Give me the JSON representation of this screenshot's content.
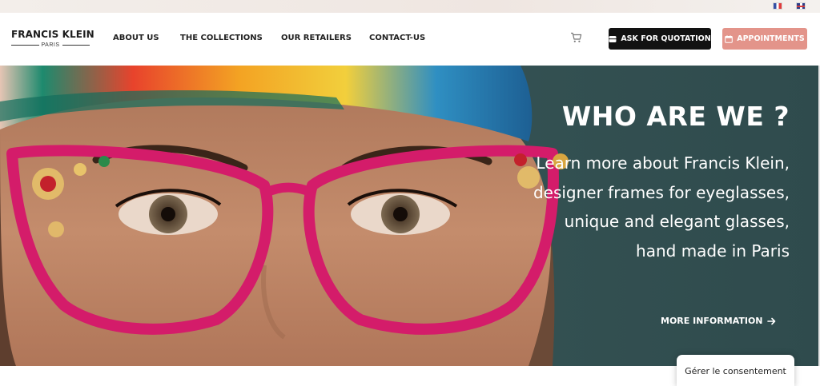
{
  "flags": [
    {
      "icon": "french-flag-icon"
    },
    {
      "icon": "english-flag-icon"
    }
  ],
  "logo": {
    "name": "FRANCIS KLEIN",
    "subtitle": "PARIS"
  },
  "nav": {
    "items": [
      {
        "label": "ABOUT US"
      },
      {
        "label": "THE COLLECTIONS"
      },
      {
        "label": "OUR RETAILERS"
      },
      {
        "label": "CONTACT-US"
      }
    ]
  },
  "header": {
    "cart_icon": "cart-icon",
    "quote_button": "ASK FOR QUOTATION",
    "appointments_button": "APPOINTMENTS"
  },
  "hero": {
    "title": "WHO ARE WE ?",
    "lines": [
      "Learn more about Francis Klein,",
      "designer frames for eyeglasses,",
      "unique and elegant glasses,",
      "hand made in Paris"
    ],
    "more_link": "MORE INFORMATION"
  },
  "consent": {
    "label": "Gérer le consentement"
  },
  "colors": {
    "quote_bg": "#121212",
    "appointments_bg": "#e3948a",
    "hero_bg": "#3c5d5e",
    "frames": "#d41c6a"
  }
}
